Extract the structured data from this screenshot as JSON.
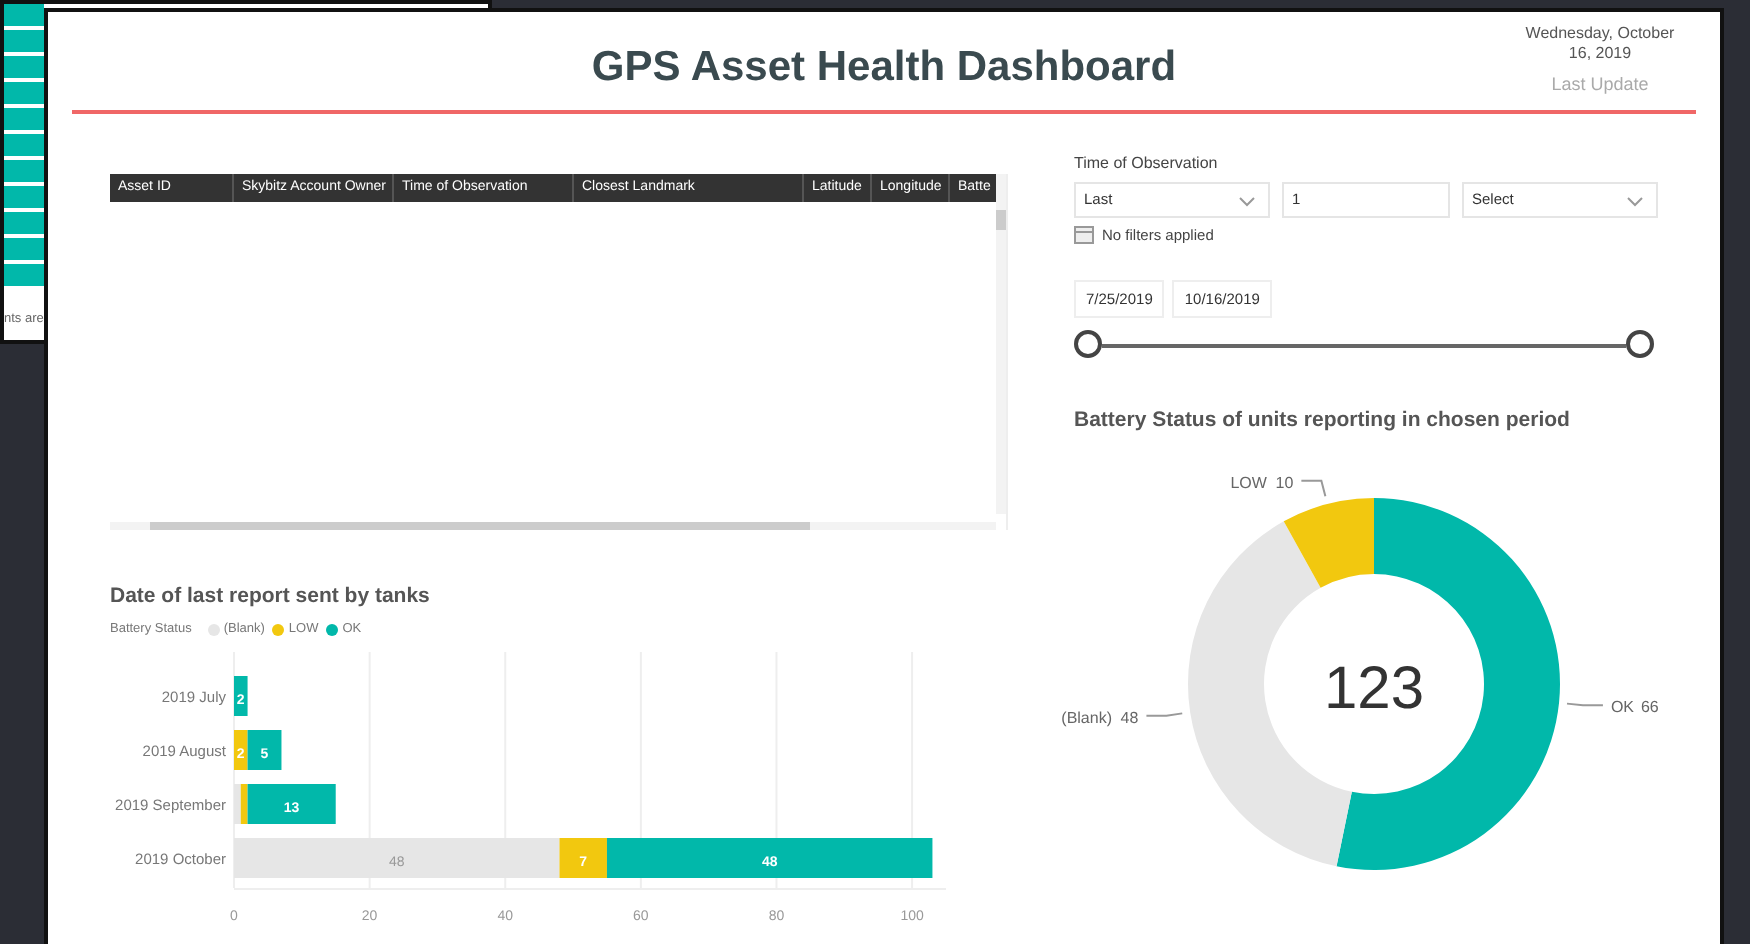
{
  "background_window": {
    "text": "nts are"
  },
  "header": {
    "title": "GPS Asset Health Dashboard",
    "date": "Wednesday, October 16, 2019",
    "date_caption": "Last Update"
  },
  "table": {
    "columns": [
      "Asset ID",
      "Skybitz Account Owner",
      "Time of Observation",
      "Closest Landmark",
      "Latitude",
      "Longitude",
      "Batte"
    ]
  },
  "slicer": {
    "label": "Time of Observation",
    "mode": "Last",
    "count": "1",
    "unit": "Select",
    "filter_note": "No filters applied",
    "start_date": "7/25/2019",
    "end_date": "10/16/2019",
    "handles": [
      {
        "level": 0
      },
      {
        "level": 1
      }
    ]
  },
  "bar_chart": {
    "legend_title": "Battery Status",
    "chart_data": {
      "type": "bar",
      "orientation": "horizontal",
      "stacked": true,
      "grid": true,
      "title": "Date of last report sent by tanks",
      "categories": [
        "2019 July",
        "2019 August",
        "2019 September",
        "2019 October"
      ],
      "series": [
        {
          "name": "(Blank)",
          "color": "#e6e6e6",
          "values": [
            0,
            0,
            1,
            48
          ],
          "value_labels": [
            null,
            null,
            null,
            "48"
          ]
        },
        {
          "name": "LOW",
          "color": "#f2c80f",
          "values": [
            0,
            2,
            1,
            7
          ],
          "value_labels": [
            null,
            "2",
            null,
            "7"
          ]
        },
        {
          "name": "OK",
          "color": "#01b8aa",
          "values": [
            2,
            5,
            13,
            48
          ],
          "value_labels": [
            "2",
            "5",
            "13",
            "48"
          ]
        }
      ],
      "xlim": [
        0,
        105
      ],
      "xticks": [
        0,
        20,
        40,
        60,
        80,
        100
      ]
    }
  },
  "donut_chart": {
    "center_value": "123",
    "chart_data": {
      "type": "donut",
      "title": "Battery Status of units reporting in chosen period",
      "categories": [
        "OK",
        "(Blank)",
        "LOW"
      ],
      "values": [
        66,
        48,
        10
      ],
      "colors": [
        "#01b8aa",
        "#e6e6e6",
        "#f2c80f"
      ],
      "data_labels": true
    }
  }
}
